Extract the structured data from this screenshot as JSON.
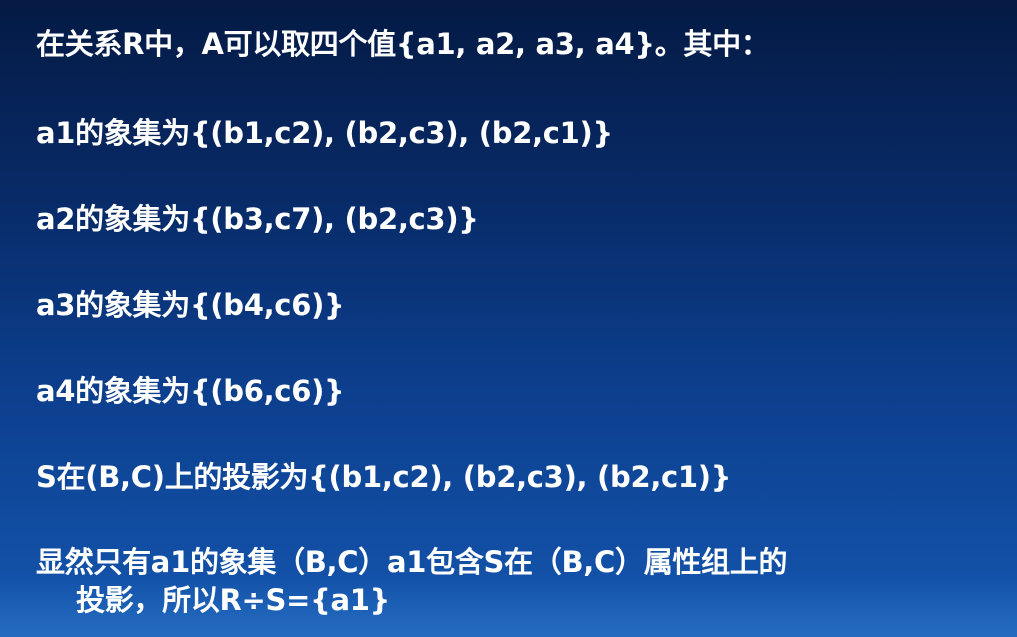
{
  "slide": {
    "lines": [
      "在关系R中，A可以取四个值{a1, a2, a3, a4}。其中：",
      "a1的象集为{(b1,c2), (b2,c3), (b2,c1)}",
      "a2的象集为{(b3,c7), (b2,c3)}",
      "a3的象集为{(b4,c6)}",
      "a4的象集为{(b6,c6)}",
      "S在(B,C)上的投影为{(b1,c2), (b2,c3), (b2,c1)}",
      "显然只有a1的象集（B,C）a1包含S在（B,C）属性组上的",
      "投影，所以R÷S={a1}"
    ]
  }
}
